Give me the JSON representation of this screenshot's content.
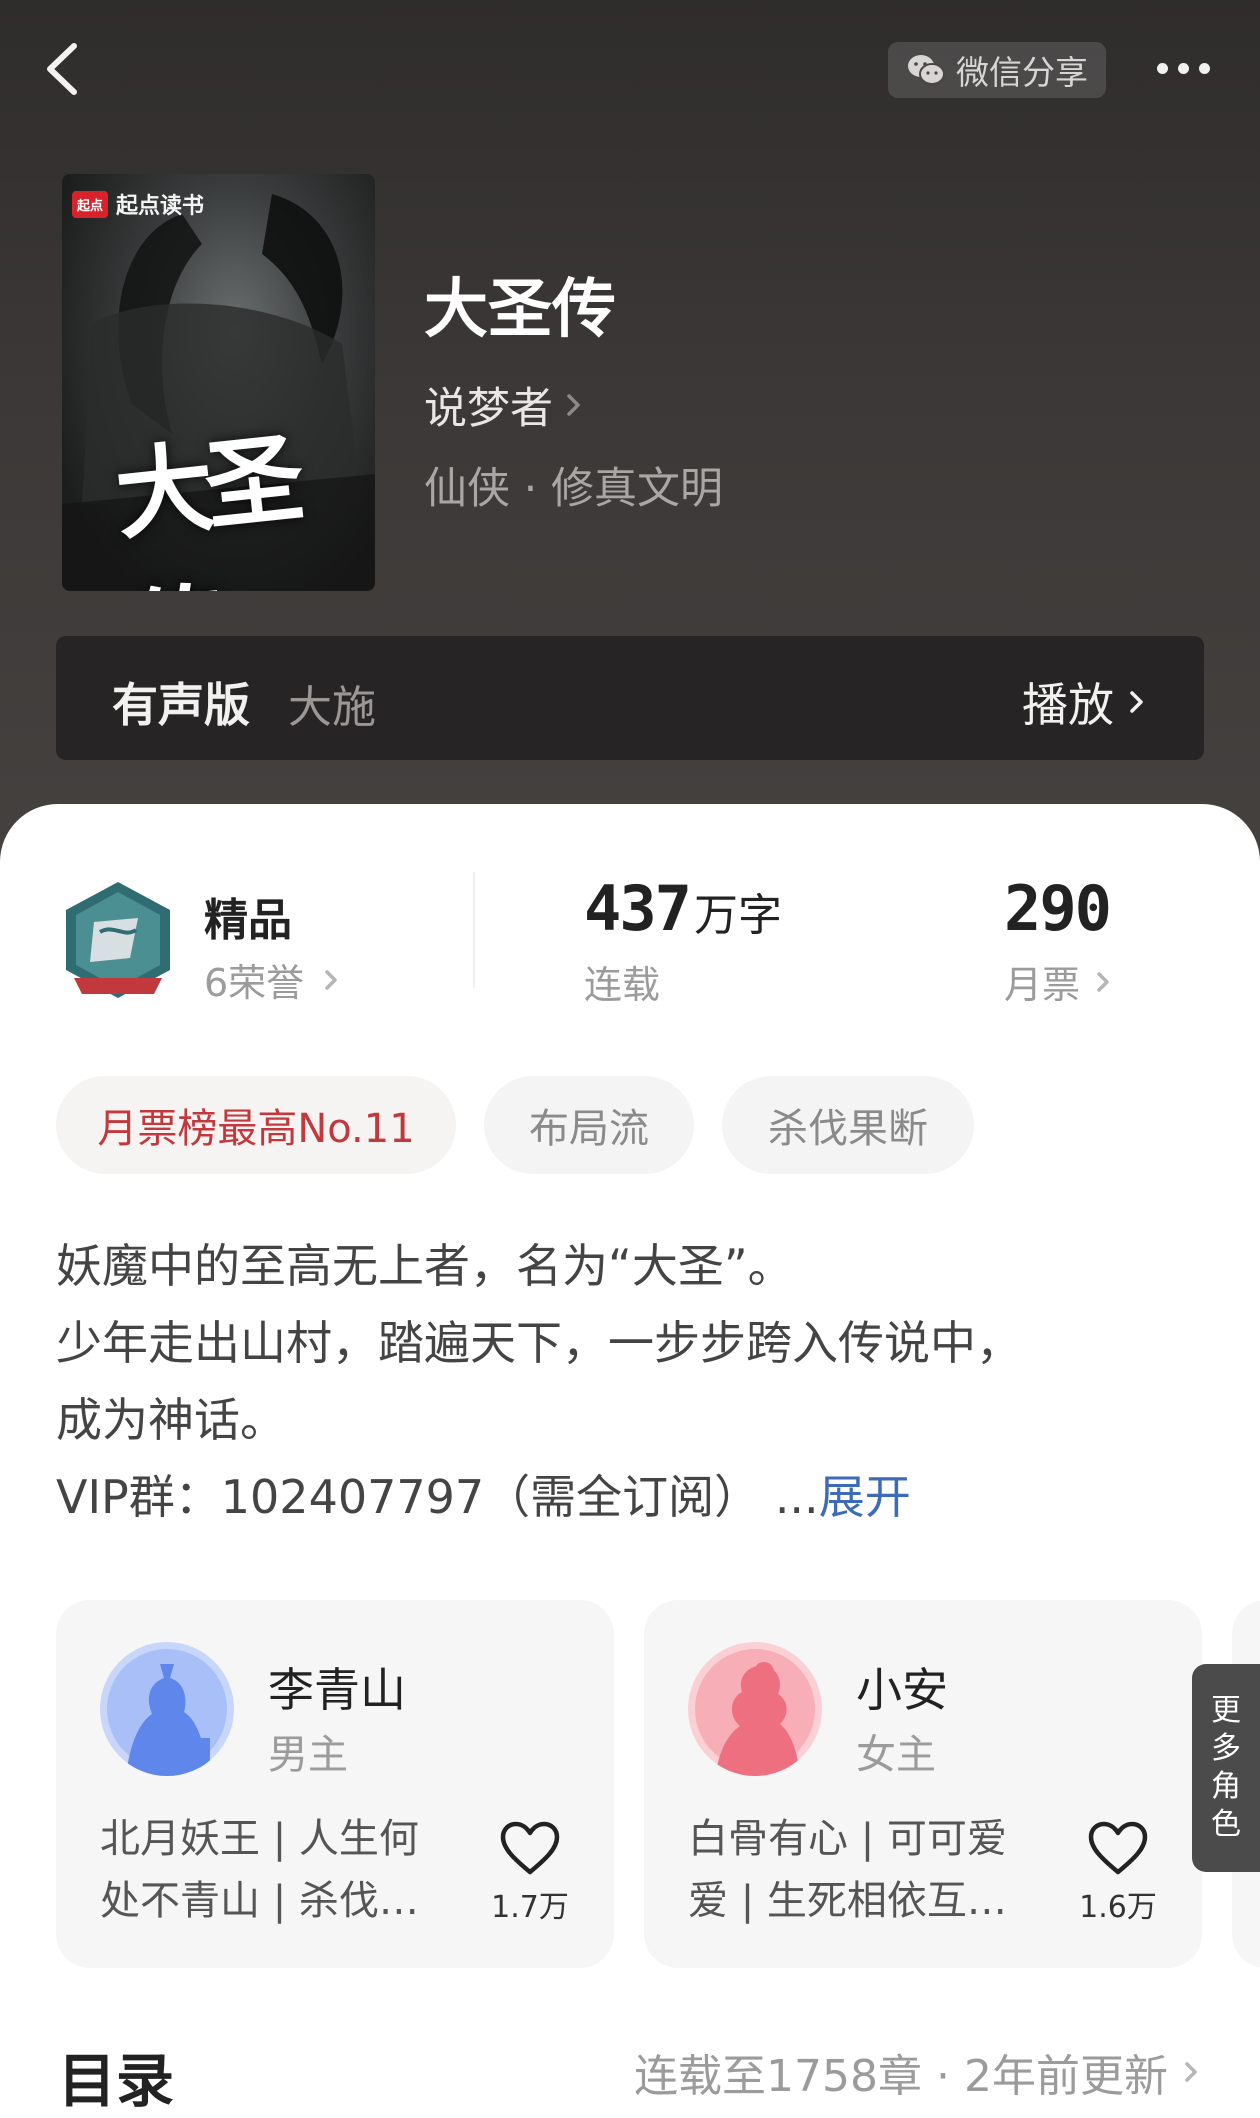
{
  "topbar": {
    "share_label": "微信分享"
  },
  "cover": {
    "brand_badge": "起点",
    "brand_name": "起点读书",
    "title_art": "大圣传"
  },
  "book": {
    "title": "大圣传",
    "author": "说梦者",
    "genre": "仙侠 · 修真文明"
  },
  "audio": {
    "label": "有声版",
    "narrator": "大施",
    "play_label": "播放"
  },
  "stats": {
    "quality": "精品",
    "honors": "6荣誉",
    "words_number": "437",
    "words_unit": "万字",
    "status": "连载",
    "monthly_tickets": "290",
    "monthly_tickets_label": "月票"
  },
  "tags": [
    "月票榜最高No.11",
    "布局流",
    "杀伐果断"
  ],
  "synopsis": {
    "lines": [
      "妖魔中的至高无上者，名为“大圣”。",
      "少年走出山村，踏遍天下，一步步跨入传说中，",
      "成为神话。",
      "VIP群：102407797（需全订阅）"
    ],
    "ellipsis": "...",
    "expand_label": "展开"
  },
  "roles": [
    {
      "name": "李青山",
      "type": "男主",
      "desc_line1": "北月妖王 | 人生何",
      "desc_line2": "处不青山 | 杀伐…",
      "likes": "1.7万"
    },
    {
      "name": "小安",
      "type": "女主",
      "desc_line1": "白骨有心 | 可可爱",
      "desc_line2": "爱 | 生死相依互…",
      "likes": "1.6万"
    }
  ],
  "more_roles_label": "更多角色",
  "toc": {
    "title": "目录",
    "meta": "连载至1758章 · 2年前更新"
  },
  "colors": {
    "hero_bg": "#3b3837",
    "hot_tag": "#c2393d",
    "expand_link": "#3d6bb8",
    "male_avatar": "#7f9ef0",
    "female_avatar": "#f17f8d"
  }
}
